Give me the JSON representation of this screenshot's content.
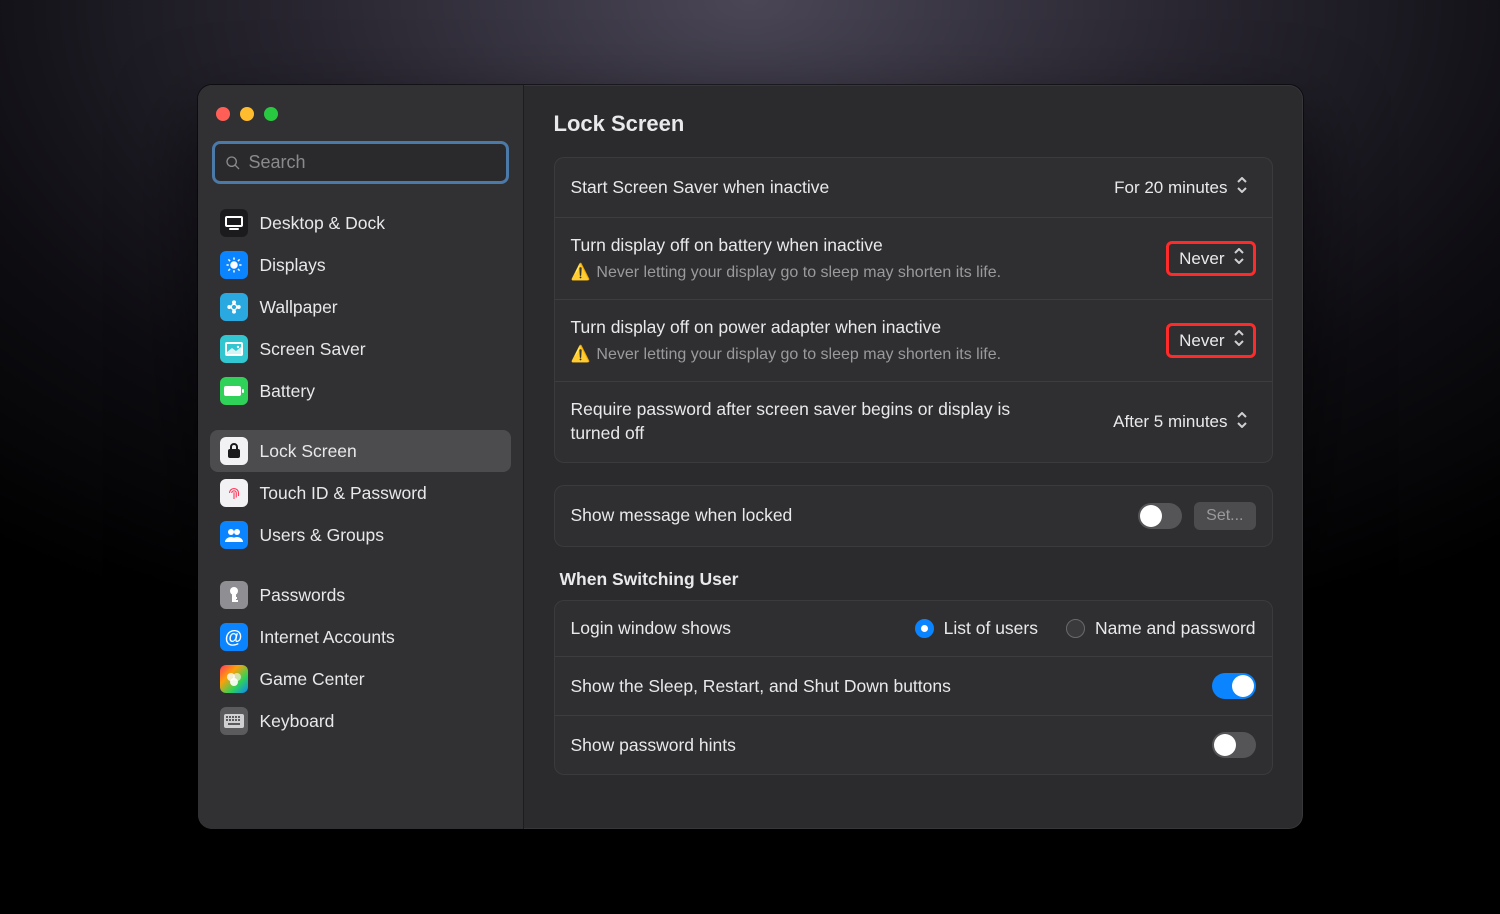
{
  "search": {
    "placeholder": "Search"
  },
  "sidebar": {
    "groups": [
      [
        {
          "label": "Desktop & Dock",
          "icon": "desktop-dock-icon"
        },
        {
          "label": "Displays",
          "icon": "displays-icon"
        },
        {
          "label": "Wallpaper",
          "icon": "wallpaper-icon"
        },
        {
          "label": "Screen Saver",
          "icon": "screensaver-icon"
        },
        {
          "label": "Battery",
          "icon": "battery-icon"
        }
      ],
      [
        {
          "label": "Lock Screen",
          "icon": "lock-screen-icon",
          "selected": true
        },
        {
          "label": "Touch ID & Password",
          "icon": "touchid-icon"
        },
        {
          "label": "Users & Groups",
          "icon": "users-groups-icon"
        }
      ],
      [
        {
          "label": "Passwords",
          "icon": "passwords-icon"
        },
        {
          "label": "Internet Accounts",
          "icon": "internet-accounts-icon"
        },
        {
          "label": "Game Center",
          "icon": "gamecenter-icon"
        },
        {
          "label": "Keyboard",
          "icon": "keyboard-icon"
        }
      ]
    ]
  },
  "main": {
    "title": "Lock Screen",
    "rows": {
      "screensaver": {
        "label": "Start Screen Saver when inactive",
        "value": "For 20 minutes"
      },
      "battery": {
        "label": "Turn display off on battery when inactive",
        "warning": "Never letting your display go to sleep may shorten its life.",
        "value": "Never",
        "highlight": true
      },
      "power": {
        "label": "Turn display off on power adapter when inactive",
        "warning": "Never letting your display go to sleep may shorten its life.",
        "value": "Never",
        "highlight": true
      },
      "password": {
        "label": "Require password after screen saver begins or display is turned off",
        "value": "After 5 minutes"
      }
    },
    "message_row": {
      "label": "Show message when locked",
      "toggle": false,
      "button": "Set..."
    },
    "switching_header": "When Switching User",
    "login_window": {
      "label": "Login window shows",
      "options": [
        "List of users",
        "Name and password"
      ],
      "selected": 0
    },
    "sleep_buttons": {
      "label": "Show the Sleep, Restart, and Shut Down buttons",
      "toggle": true
    },
    "hints": {
      "label": "Show password hints",
      "toggle": false
    }
  }
}
